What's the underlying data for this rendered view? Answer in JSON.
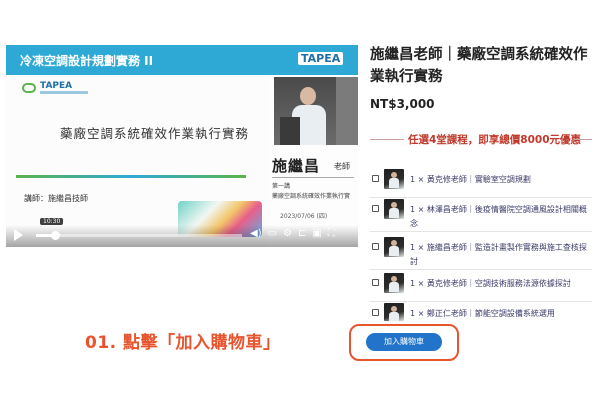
{
  "video": {
    "course_banner": "冷凍空調設計規劃實務 II",
    "banner_logo": "TAPEA",
    "slide_logo": "TAPEA",
    "slide_title": "藥廠空調系統確效作業執行實務",
    "slide_instructor": "講師：施繼昌技師",
    "right_logo": "TAPEA",
    "teacher_name": "施繼昌",
    "teacher_suffix": "老師",
    "lesson_no": "第一講",
    "lesson_topic": "藥廠空調系統確效作業執行實",
    "date": "2023/07/06 (四)",
    "hover_time": "10:30",
    "progress_fraction": 0.09,
    "controls": {
      "volume_icon": "volume-icon",
      "cc_icon": "closed-captions-icon",
      "settings_icon": "gear-icon",
      "cast_icon": "cast-icon",
      "pip_icon": "picture-in-picture-icon",
      "fullscreen_icon": "fullscreen-icon"
    }
  },
  "product": {
    "title": "施繼昌老師｜藥廠空調系統確效作業執行實務",
    "price": "NT$3,000",
    "promo": "任選4堂課程，即享總價8000元優惠"
  },
  "bundle_items": [
    {
      "label": "1 × 黃克修老師｜實驗室空調規劃"
    },
    {
      "label": "1 × 林澤昌老師｜後疫情醫院空調通風設計相關概念"
    },
    {
      "label": "1 × 施繼昌老師｜監造計畫製作實務與施工查核探討"
    },
    {
      "label": "1 × 黃克修老師｜空調技術服務法源依據探討"
    },
    {
      "label": "1 × 鄭正仁老師｜節能空調設備系統選用"
    }
  ],
  "cart": {
    "button_label": "加入購物車"
  },
  "annotation": {
    "step_label": "01. 點擊「加入購物車」"
  },
  "colors": {
    "banner": "#2ea9d6",
    "accent_orange": "#e8542e",
    "button_blue": "#2174c9",
    "promo_red": "#c0392b"
  }
}
